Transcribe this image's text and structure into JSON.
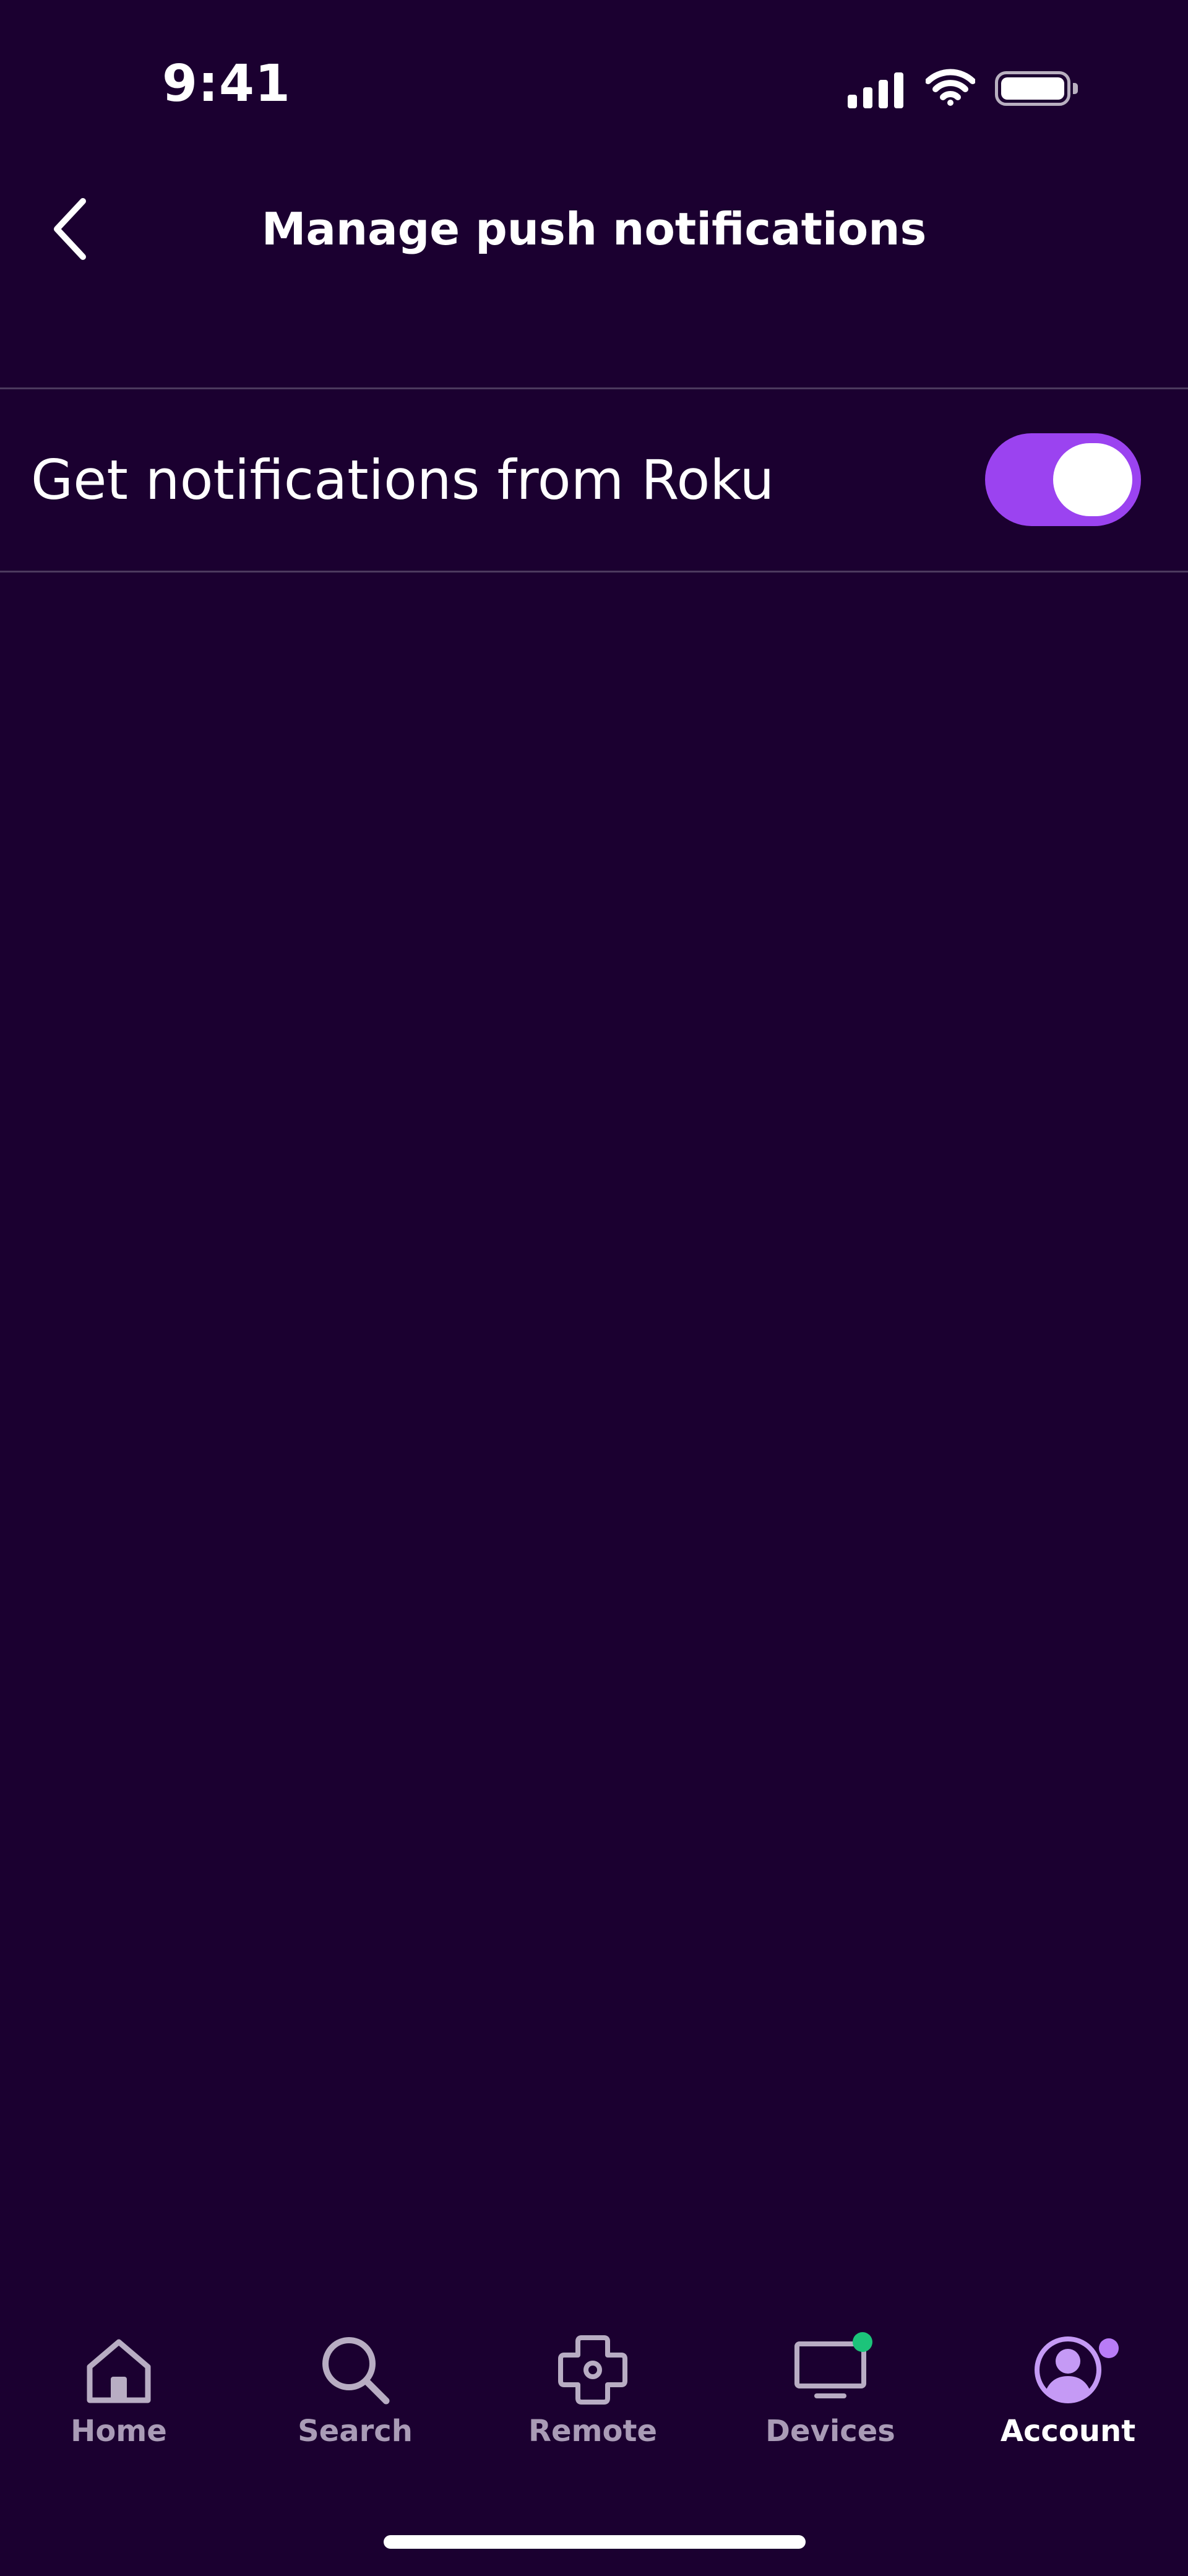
{
  "status_bar": {
    "time": "9:41"
  },
  "header": {
    "title": "Manage push notifications"
  },
  "settings": {
    "rows": [
      {
        "label": "Get notifications from Roku",
        "toggle_on": true
      }
    ]
  },
  "tab_bar": {
    "tabs": [
      {
        "label": "Home",
        "icon": "home-icon",
        "active": false
      },
      {
        "label": "Search",
        "icon": "search-icon",
        "active": false
      },
      {
        "label": "Remote",
        "icon": "remote-dpad-icon",
        "active": false
      },
      {
        "label": "Devices",
        "icon": "tv-icon",
        "active": false
      },
      {
        "label": "Account",
        "icon": "account-icon",
        "active": true
      }
    ]
  },
  "colors": {
    "background": "#1b0030",
    "accent": "#9b43f0",
    "devices_dot": "#1cc47a",
    "account_dot": "#b97cf7",
    "inactive_tab": "#a99bb6"
  }
}
